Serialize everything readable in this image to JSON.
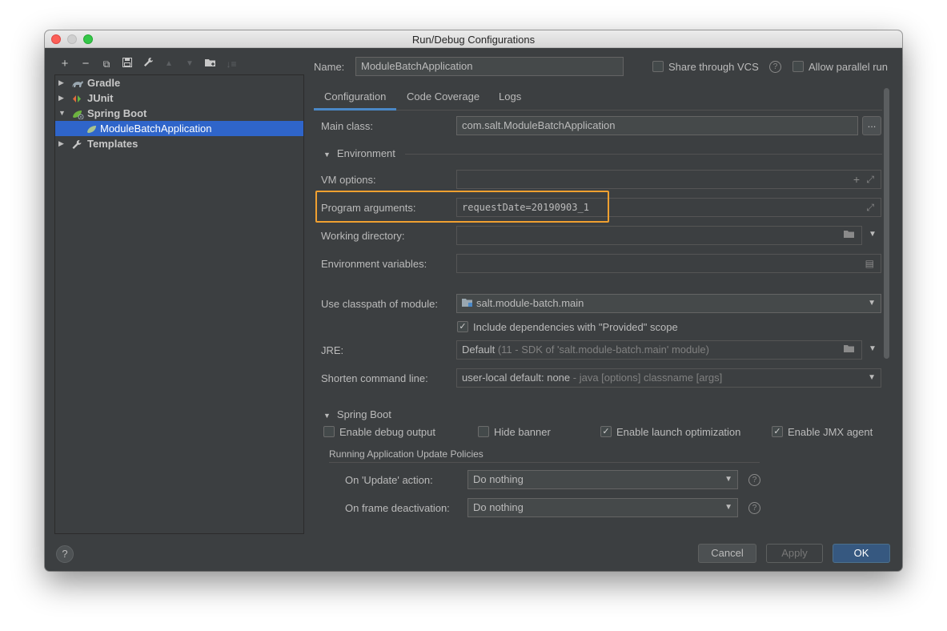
{
  "window": {
    "title": "Run/Debug Configurations"
  },
  "left": {
    "toolbar": [
      "+",
      "−",
      "copy",
      "save",
      "wrench",
      "up",
      "down",
      "folder",
      "sort"
    ],
    "tree": [
      {
        "label": "Gradle"
      },
      {
        "label": "JUnit"
      },
      {
        "label": "Spring Boot"
      },
      {
        "label": "ModuleBatchApplication"
      },
      {
        "label": "Templates"
      }
    ]
  },
  "header": {
    "name_label": "Name:",
    "name_value": "ModuleBatchApplication",
    "share_vcs": "Share through VCS",
    "allow_parallel": "Allow parallel run"
  },
  "tabs": [
    "Configuration",
    "Code Coverage",
    "Logs"
  ],
  "config": {
    "main_class_label": "Main class:",
    "main_class_value": "com.salt.ModuleBatchApplication",
    "dots": "...",
    "environment": "Environment",
    "vm_label": "VM options:",
    "prog_label": "Program arguments:",
    "prog_value": "requestDate=20190903_1",
    "workdir_label": "Working directory:",
    "envvars_label": "Environment variables:",
    "classpath_label": "Use classpath of module:",
    "classpath_value": "salt.module-batch.main",
    "include_deps": "Include dependencies with \"Provided\" scope",
    "jre_label": "JRE:",
    "jre_default": "Default",
    "jre_detail": "(11 - SDK of 'salt.module-batch.main' module)",
    "shorten_label": "Shorten command line:",
    "shorten_value": "user-local default: none",
    "shorten_detail": "- java [options] classname [args]"
  },
  "spring": {
    "section": "Spring Boot",
    "debug_output": "Enable debug output",
    "hide_banner": "Hide banner",
    "launch_opt": "Enable launch optimization",
    "jmx_agent": "Enable JMX agent",
    "policies": "Running Application Update Policies",
    "update_label": "On 'Update' action:",
    "update_value": "Do nothing",
    "frame_label": "On frame deactivation:",
    "frame_value": "Do nothing"
  },
  "footer": {
    "help": "?",
    "cancel": "Cancel",
    "apply": "Apply",
    "ok": "OK"
  },
  "colors": {
    "accent": "#2f65ca",
    "highlight": "#f0a030",
    "ok": "#365880"
  }
}
